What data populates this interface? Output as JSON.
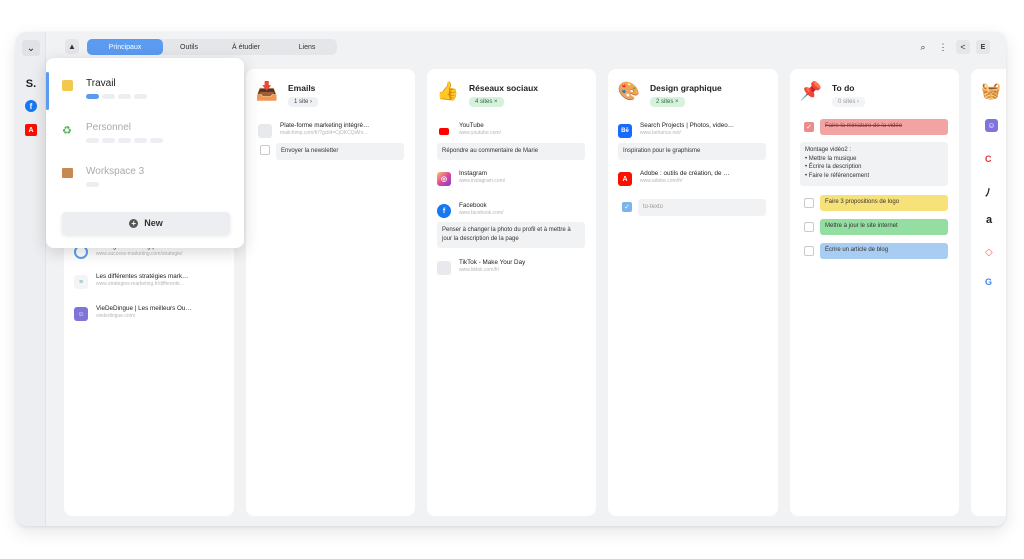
{
  "rail": {
    "chevron": "⌄",
    "logo": "S.",
    "facebook": "f",
    "adobe": "A"
  },
  "tabs": [
    "Principaux",
    "Outils",
    "À étudier",
    "Liens"
  ],
  "toolbar": {
    "search": "⌕",
    "more": "⋮",
    "share": "<",
    "avatar": "E"
  },
  "popup": {
    "workspaces": [
      {
        "name": "Travail",
        "icon": "folder-icon"
      },
      {
        "name": "Personnel",
        "icon": "recycle-icon"
      },
      {
        "name": "Workspace 3",
        "icon": "box-icon"
      }
    ],
    "new_label": "New"
  },
  "col1": {
    "sites": [
      {
        "name": "Stratégie marketing pour Gras…",
        "url": "www.success-marketing.com/strategie/"
      },
      {
        "name": "Les différentes stratégies mark…",
        "url": "www.strategies-marketing.fr/differente…"
      },
      {
        "name": "VieDeDingue | Les meilleurs Ou…",
        "url": "viededingue.com/"
      }
    ]
  },
  "emails": {
    "title": "Emails",
    "badge": "1 site ›",
    "site": {
      "name": "Plate-forme marketing intégré…",
      "url": "mailchimp.com/fr/?gclid=CjOKCQiAhi…"
    },
    "note": "Envoyer la newsletter"
  },
  "social": {
    "title": "Réseaux sociaux",
    "badge": "4 sites ×",
    "sites": [
      {
        "name": "YouTube",
        "url": "www.youtube.com/"
      },
      {
        "name": "Instagram",
        "url": "www.instagram.com/"
      },
      {
        "name": "Facebook",
        "url": "www.facebook.com/"
      },
      {
        "name": "TikTok - Make Your Day",
        "url": "www.tiktok.com/fr/"
      }
    ],
    "notes": [
      "Répondre au commentaire de Marie",
      "Penser à changer la photo du profil et à mettre à jour la description de la page"
    ]
  },
  "design": {
    "title": "Design graphique",
    "badge": "2 sites ×",
    "sites": [
      {
        "name": "Search Projects | Photos, video…",
        "url": "www.behance.net/"
      },
      {
        "name": "Adobe : outils de création, de …",
        "url": "www.adobe.com/fr/"
      }
    ],
    "note": "Inspiration pour le graphisme",
    "todo": "to-texto"
  },
  "todo": {
    "title": "To do",
    "badge": "0 sites ›",
    "items": [
      {
        "text": "Faire la miniature de la vidéo",
        "done": true,
        "color": "#f2a3a3"
      },
      {
        "text": "Faire 3 propositions de logo",
        "done": false,
        "color": "#f7e27a"
      },
      {
        "text": "Mettre à jour le site internet",
        "done": false,
        "color": "#93dea0"
      },
      {
        "text": "Écrire un article de blog",
        "done": false,
        "color": "#a9cdf2"
      }
    ],
    "note_title": "Montage vidéo2 :",
    "note_lines": [
      "• Mettre la musique",
      "• Écrire la description",
      "• Faire le référencement"
    ]
  },
  "right_icons": [
    "basket-icon",
    "viededingue-icon",
    "canva-icon",
    "patreon-icon",
    "amazon-icon",
    "airbnb-icon",
    "google-icon"
  ],
  "right_glyphs": {
    "canva": "C",
    "amazon": "a",
    "google": "G"
  }
}
